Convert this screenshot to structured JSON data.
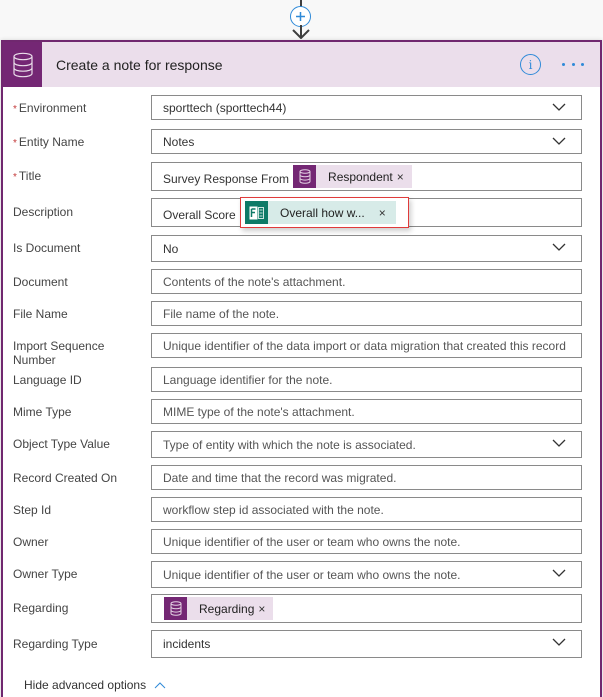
{
  "connector": {
    "add_icon": "plus-circle-icon",
    "arrow_icon": "arrow-down-icon"
  },
  "card": {
    "title": "Create a note for response",
    "icon": "database-icon",
    "info_icon": "info-icon",
    "info_glyph": "i",
    "more_icon": "ellipsis-icon",
    "accent_color": "#742774",
    "header_bg": "#ebdeeb"
  },
  "fields": {
    "environment": {
      "label": "Environment",
      "required": true,
      "value": "sporttech (sporttech44)",
      "type": "dropdown"
    },
    "entity_name": {
      "label": "Entity Name",
      "required": true,
      "value": "Notes",
      "type": "dropdown"
    },
    "title": {
      "label": "Title",
      "required": true,
      "prefix": "Survey Response From",
      "token": {
        "label": "Respondent",
        "icon": "database-icon",
        "source": "Common Data Service"
      }
    },
    "description": {
      "label": "Description",
      "prefix": "Overall Score :",
      "dragging_token": {
        "label": "Overall how w...",
        "icon": "forms-icon",
        "source": "Microsoft Forms"
      }
    },
    "is_document": {
      "label": "Is Document",
      "value": "No",
      "type": "dropdown"
    },
    "document": {
      "label": "Document",
      "placeholder": "Contents of the note's attachment."
    },
    "file_name": {
      "label": "File Name",
      "placeholder": "File name of the note."
    },
    "import_sequence_number": {
      "label": "Import Sequence Number",
      "placeholder": "Unique identifier of the data import or data migration that created this record"
    },
    "language_id": {
      "label": "Language ID",
      "placeholder": "Language identifier for the note."
    },
    "mime_type": {
      "label": "Mime Type",
      "placeholder": "MIME type of the note's attachment."
    },
    "object_type_value": {
      "label": "Object Type Value",
      "placeholder": "Type of entity with which the note is associated.",
      "type": "dropdown"
    },
    "record_created_on": {
      "label": "Record Created On",
      "placeholder": "Date and time that the record was migrated."
    },
    "step_id": {
      "label": "Step Id",
      "placeholder": "workflow step id associated with the note."
    },
    "owner": {
      "label": "Owner",
      "placeholder": "Unique identifier of the user or team who owns the note."
    },
    "owner_type": {
      "label": "Owner Type",
      "placeholder": "Unique identifier of the user or team who owns the note.",
      "type": "dropdown"
    },
    "regarding": {
      "label": "Regarding",
      "token": {
        "label": "Regarding",
        "icon": "database-icon"
      }
    },
    "regarding_type": {
      "label": "Regarding Type",
      "value": "incidents",
      "type": "dropdown"
    }
  },
  "required_marker": "*",
  "token_remove_glyph": "×",
  "advanced_toggle": {
    "label": "Hide advanced options",
    "icon": "chevron-up-icon"
  }
}
